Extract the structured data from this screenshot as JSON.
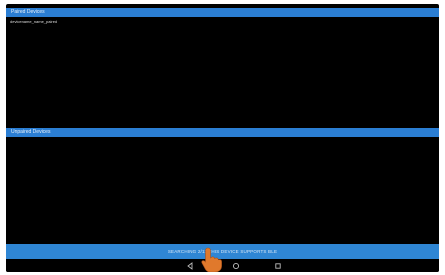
{
  "paired": {
    "header": "Paired Devices",
    "devices": [
      "devicename_name_paired"
    ]
  },
  "unpaired": {
    "header": "Unpaired Devices",
    "devices": []
  },
  "status": {
    "text": "SEARCHING 2/11 THIS DEVICE SUPPORTS BLE"
  },
  "nav": {
    "back_icon": "back-triangle-icon",
    "home_icon": "home-circle-icon",
    "recents_icon": "recents-square-icon"
  },
  "colors": {
    "header_blue": "#2b7ed3",
    "status_blue": "#2f86d4",
    "background": "#000000"
  }
}
